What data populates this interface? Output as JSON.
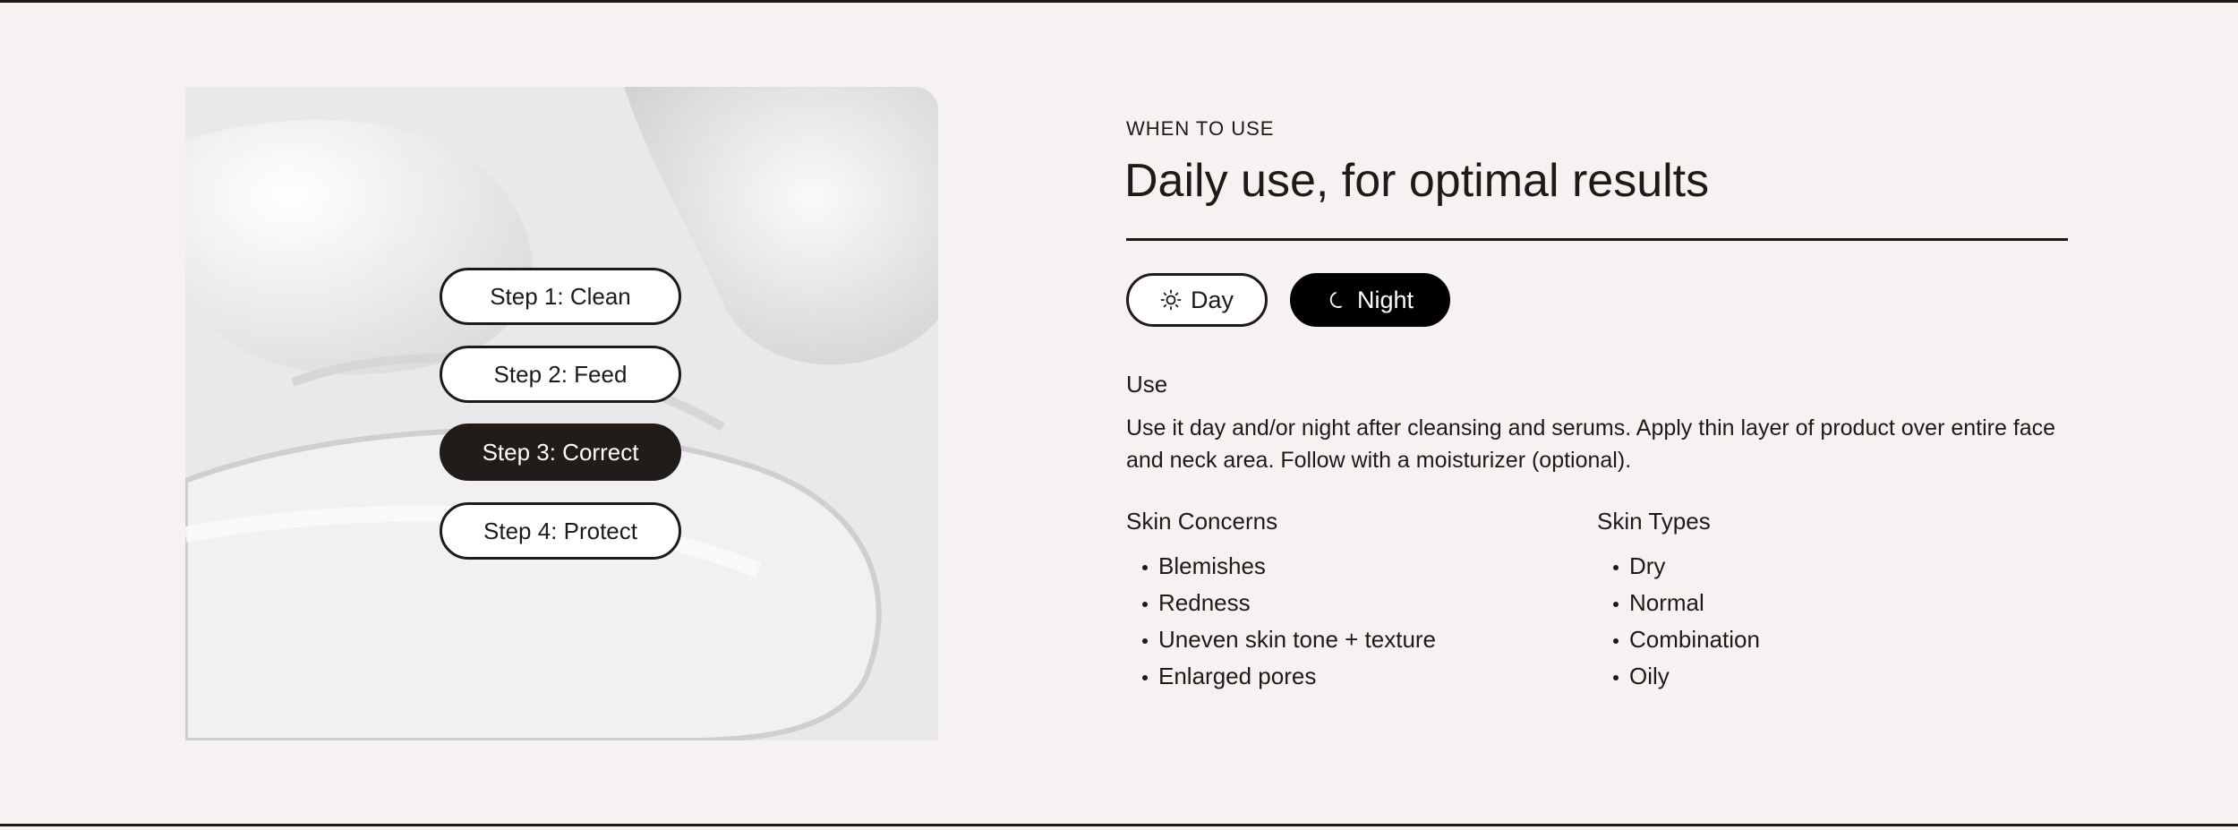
{
  "steps": {
    "items": [
      {
        "label": "Step 1: Clean",
        "active": false
      },
      {
        "label": "Step 2: Feed",
        "active": false
      },
      {
        "label": "Step 3: Correct",
        "active": true
      },
      {
        "label": "Step 4: Protect",
        "active": false
      }
    ]
  },
  "content": {
    "eyebrow": "WHEN TO USE",
    "title": "Daily use, for optimal results",
    "toggles": {
      "day": {
        "label": "Day",
        "icon": "sun-icon",
        "selected": false
      },
      "night": {
        "label": "Night",
        "icon": "moon-icon",
        "selected": true
      }
    },
    "use_heading": "Use",
    "use_text": "Use it day and/or night after cleansing and serums. Apply thin layer of product over entire face and neck area. Follow with a moisturizer (optional).",
    "skin_concerns": {
      "heading": "Skin Concerns",
      "items": [
        "Blemishes",
        "Redness",
        "Uneven skin tone + texture",
        "Enlarged pores"
      ]
    },
    "skin_types": {
      "heading": "Skin Types",
      "items": [
        "Dry",
        "Normal",
        "Combination",
        "Oily"
      ]
    }
  },
  "colors": {
    "background": "#f6f2f1",
    "text": "#1e1a17",
    "active_step": "#211c19",
    "night_toggle": "#000000"
  }
}
